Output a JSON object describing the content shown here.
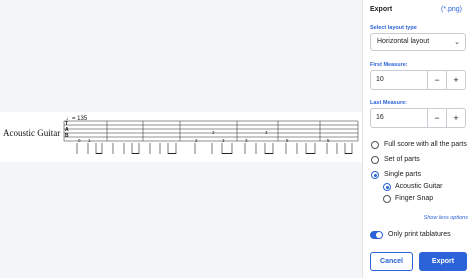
{
  "preview": {
    "instrument": "Acoustic Guitar",
    "tempo": "♩= 135",
    "tab_clef": [
      "T",
      "A",
      "B"
    ],
    "measures": [
      [
        "0",
        "1"
      ],
      [
        "0",
        "1"
      ],
      [
        "2",
        "3",
        "2",
        "3"
      ],
      [
        "3",
        "3",
        "3",
        "3"
      ],
      [
        "2",
        "3",
        "3",
        "2"
      ],
      [
        "2",
        "3",
        "3",
        "2"
      ],
      [
        "5",
        "5",
        "5",
        "5"
      ]
    ]
  },
  "panel": {
    "title": "Export",
    "extension": "(*.png)",
    "layout_label": "Select layout type",
    "layout_value": "Horizontal layout",
    "first_label": "First Measure:",
    "first_value": "10",
    "last_label": "Last Measure:",
    "last_value": "16",
    "minus": "−",
    "plus": "+",
    "options": {
      "full": "Full score with all the parts",
      "set": "Set of parts",
      "single": "Single parts"
    },
    "selected_option": "single",
    "parts": [
      "Acoustic Guitar",
      "Finger Snap"
    ],
    "selected_part": "Acoustic Guitar",
    "show_less": "Show less options",
    "tab_toggle_label": "Only print tablatures",
    "tab_toggle_on": true,
    "cancel": "Cancel",
    "export": "Export",
    "accent_color": "#2c63d9"
  },
  "icons": [
    "chevron-down-icon",
    "radio-icon",
    "toggle-icon"
  ]
}
